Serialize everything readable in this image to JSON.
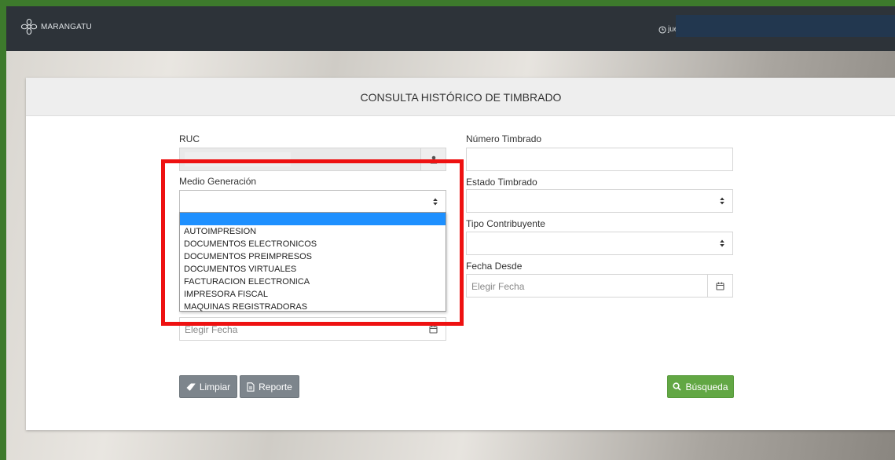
{
  "header": {
    "brand": "MARANGATU",
    "clock_text": "jue."
  },
  "panel": {
    "title": "CONSULTA HISTÓRICO DE TIMBRADO"
  },
  "form": {
    "ruc": {
      "label": "RUC",
      "value": ""
    },
    "numero_timbrado": {
      "label": "Número Timbrado",
      "value": ""
    },
    "medio_generacion": {
      "label": "Medio Generación",
      "value": "",
      "options": [
        "",
        "AUTOIMPRESION",
        "DOCUMENTOS ELECTRONICOS",
        "DOCUMENTOS PREIMPRESOS",
        "DOCUMENTOS VIRTUALES",
        "FACTURACION ELECTRONICA",
        "IMPRESORA FISCAL",
        "MAQUINAS REGISTRADORAS"
      ]
    },
    "estado_timbrado": {
      "label": "Estado Timbrado",
      "value": ""
    },
    "tipo_contribuyente": {
      "label": "Tipo Contribuyente",
      "value": ""
    },
    "fecha_desde": {
      "label": "Fecha Desde",
      "placeholder": "Elegir Fecha"
    },
    "fecha_hasta": {
      "placeholder": "Elegir Fecha"
    }
  },
  "buttons": {
    "limpiar": "Limpiar",
    "reporte": "Reporte",
    "busqueda": "Búsqueda"
  },
  "colors": {
    "topbar": "#2d3339",
    "highlight": "#ee1111",
    "primary_button": "#62a744",
    "secondary_button": "#7d858c",
    "selected_option": "#1e90ff"
  }
}
